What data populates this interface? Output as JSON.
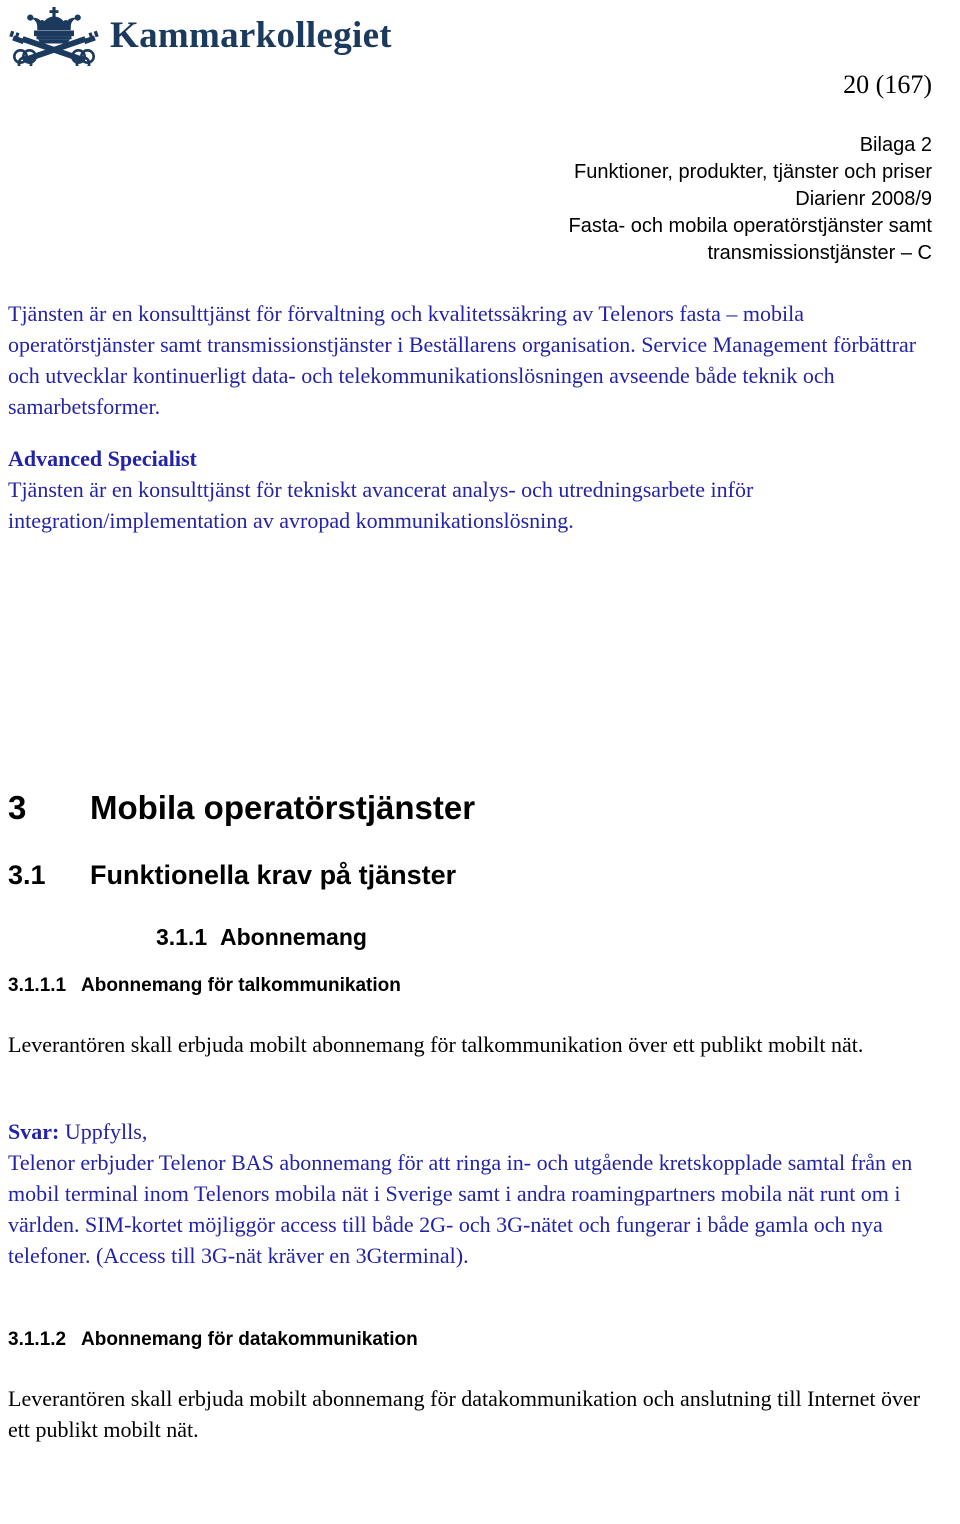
{
  "logo": {
    "wordmark": "Kammarkollegiet",
    "mark_icon": "crown-and-crossed-keys-icon",
    "mark_color": "#1b3a5e"
  },
  "header": {
    "page_number": "20 (167)",
    "lines": [
      "Bilaga 2",
      "Funktioner, produkter, tjänster och priser",
      "Diarienr 2008/9",
      "Fasta- och mobila operatörstjänster samt",
      "transmissionstjänster – C"
    ]
  },
  "colors": {
    "body_blue": "#2323a8",
    "body_black": "#000000",
    "logo_navy": "#1b3a5e"
  },
  "body": {
    "intro_paragraph": "Tjänsten är en konsulttjänst för förvaltning och kvalitetssäkring av Telenors fasta – mobila operatörstjänster samt transmissionstjänster i Beställarens organisation. Service Management förbättrar och utvecklar kontinuerligt data- och telekommunikationslösningen avseende både teknik och samarbetsformer.",
    "advanced_specialist_title": "Advanced Specialist",
    "advanced_specialist_paragraph": "Tjänsten är en konsulttjänst för tekniskt avancerat analys- och utredningsarbete inför integration/implementation av avropad kommunikationslösning."
  },
  "sections": {
    "h1": {
      "number": "3",
      "title": "Mobila operatörstjänster"
    },
    "h2": {
      "number": "3.1",
      "title": "Funktionella krav på tjänster"
    },
    "h3": {
      "number": "3.1.1",
      "title": "Abonnemang"
    },
    "h4_a": {
      "number": "3.1.1.1",
      "title": "Abonnemang för talkommunikation"
    },
    "h4_b": {
      "number": "3.1.1.2",
      "title": "Abonnemang för datakommunikation"
    }
  },
  "content": {
    "req_tal": "Leverantören skall erbjuda mobilt abonnemang för talkommunikation över ett publikt mobilt nät.",
    "svar_label": "Svar:",
    "svar_value": " Uppfylls,",
    "svar_body": "Telenor erbjuder Telenor BAS abonnemang för att ringa in- och utgående kretskopplade samtal från en mobil terminal inom Telenors mobila nät i Sverige samt i andra roamingpartners mobila nät runt om i världen. SIM-kortet möjliggör access till både 2G- och 3G-nätet och fungerar i både gamla och nya telefoner. (Access till 3G-nät kräver en 3Gterminal).",
    "req_data": "Leverantören skall erbjuda mobilt abonnemang för datakommunikation och anslutning till Internet över ett publikt mobilt nät."
  }
}
